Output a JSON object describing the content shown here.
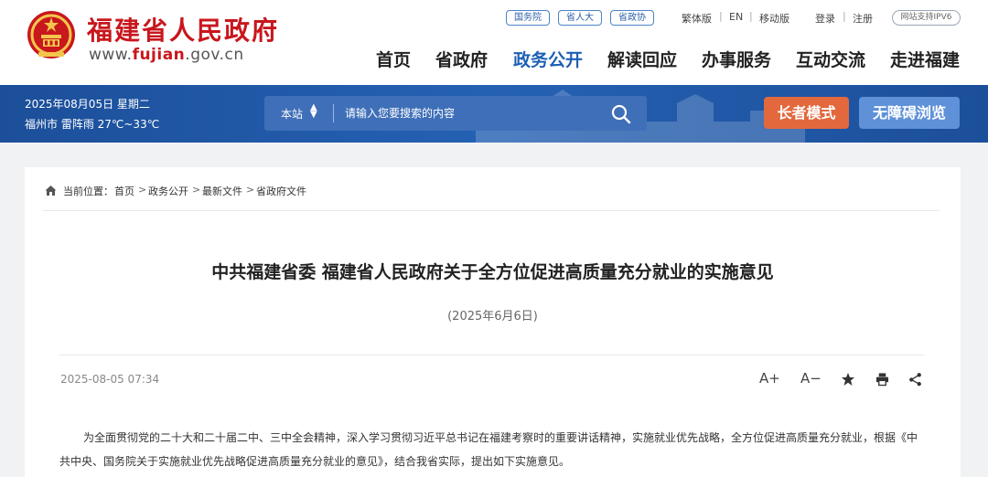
{
  "header": {
    "site_name": "福建省人民政府",
    "site_url_prefix": "www.",
    "site_url_domain": "fujian",
    "site_url_suffix": ".gov.cn",
    "links": [
      "国务院",
      "省人大",
      "省政协"
    ],
    "utility": {
      "traditional": "繁体版",
      "english": "EN",
      "mobile": "移动版",
      "login": "登录",
      "register": "注册",
      "ipv6": "网站支持IPV6"
    },
    "nav": [
      "首页",
      "省政府",
      "政务公开",
      "解读回应",
      "办事服务",
      "互动交流",
      "走进福建"
    ],
    "active_nav": "政务公开"
  },
  "band": {
    "date": "2025年08月05日 星期二",
    "weather": "福州市 雷阵雨 27℃~33℃",
    "search_scope": "本站",
    "search_placeholder": "请输入您要搜索的内容",
    "elder_mode": "长者模式",
    "accessible": "无障碍浏览"
  },
  "breadcrumb": {
    "label": "当前位置：",
    "items": [
      "首页",
      "政务公开",
      "最新文件",
      "省政府文件"
    ]
  },
  "article": {
    "title": "中共福建省委 福建省人民政府关于全方位促进高质量充分就业的实施意见",
    "issue_date": "(2025年6月6日)",
    "publish_time": "2025-08-05 07:34",
    "tools": {
      "font_up": "A+",
      "font_down": "A−"
    },
    "body_line1": "为全面贯彻党的二十大和二十届二中、三中全会精神，深入学习贯彻习近平总书记在福建考察时的重要讲话精神，实施就业优先战略，全方位促进高质量充分就业，根",
    "body_line2": "据《中共中央、国务院关于实施就业优先战略促进高质量充分就业的意见》，结合我省实际，提出如下实施意见。"
  },
  "colors": {
    "brand_red": "#c8171d",
    "nav_active_blue": "#1d5fb4",
    "band_blue": "#2561b3",
    "elder_orange": "#e3683d",
    "access_blue": "#5f91d8"
  }
}
